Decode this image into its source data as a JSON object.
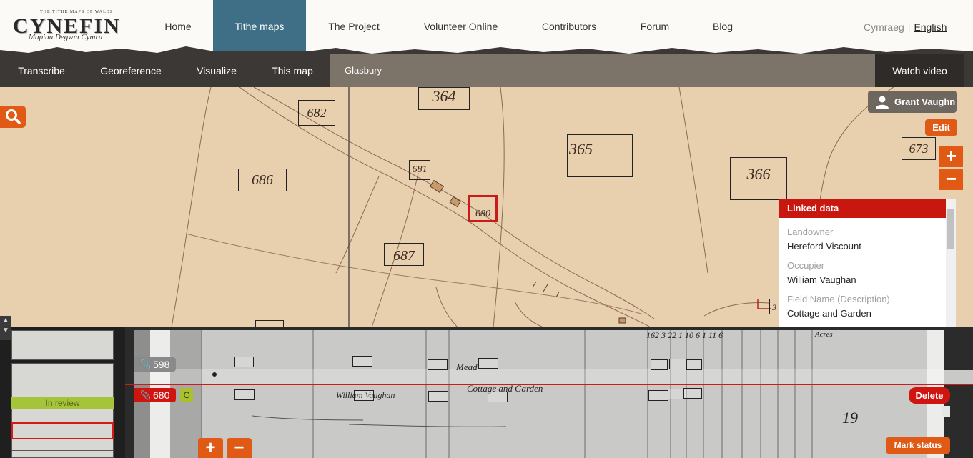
{
  "logo": {
    "small_text": "THE TITHE MAPS OF WALES",
    "title": "CYNEFIN",
    "subtitle": "Mapiau Degwm Cymru"
  },
  "main_nav": [
    "Home",
    "Tithe maps",
    "The Project",
    "Volunteer Online",
    "Contributors",
    "Forum",
    "Blog"
  ],
  "language": {
    "welsh": "Cymraeg",
    "separator": "|",
    "english": "English"
  },
  "sub_nav": {
    "items": [
      "Transcribe",
      "Georeference",
      "Visualize",
      "This map"
    ],
    "place": "Glasbury",
    "watch_video": "Watch video"
  },
  "map": {
    "user_name": "Grant Vaughn",
    "edit_label": "Edit",
    "zoom_in": "+",
    "zoom_out": "−",
    "parcels": [
      "364",
      "682",
      "686",
      "681",
      "365",
      "366",
      "673",
      "680",
      "687",
      "3"
    ]
  },
  "linked_data": {
    "header": "Linked data",
    "fields": [
      {
        "label": "Landowner",
        "value": "Hereford Viscount"
      },
      {
        "label": "Occupier",
        "value": "William Vaughan"
      },
      {
        "label": "Field Name (Description)",
        "value": "Cottage and Garden"
      }
    ]
  },
  "strip": {
    "review_status": "In review",
    "row1_number": "598",
    "row2_number": "680",
    "row2_badge": "C",
    "delete_label": "Delete",
    "mark_status_label": "Mark status",
    "zoom_in": "+",
    "zoom_out": "−",
    "handwriting": {
      "header_numbers": "162  3  22  1  10  6  1  11  6",
      "header_word": "Acres",
      "row1_text": "Mead",
      "row2_text": "Cottage and Garden",
      "row2_name": "William Vaughan",
      "side_number": "19"
    }
  },
  "colors": {
    "accent_orange": "#e05a16",
    "accent_red": "#c8170f",
    "nav_active": "#3f6f86",
    "subnav_bg": "#3b3835",
    "map_paper": "#e8cfad",
    "status_green": "#a6c43a"
  }
}
